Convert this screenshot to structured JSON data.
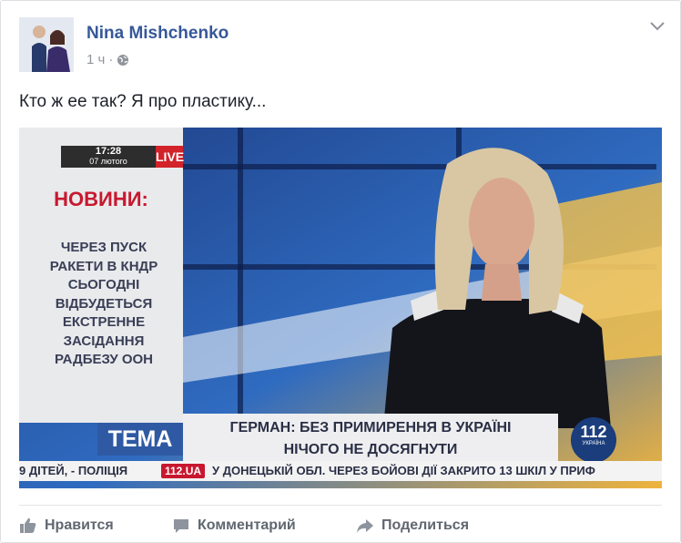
{
  "post": {
    "author": "Nina Mishchenko",
    "time": "1 ч",
    "separator": "·",
    "text": "Кто ж ее так? Я про пластику...",
    "icons": {
      "privacy": "globe-icon",
      "menu": "chevron-down-icon"
    }
  },
  "media": {
    "clock_time": "17:28",
    "clock_date": "07 лютого",
    "live_label": "LIVE",
    "news_title": "НОВИНИ:",
    "news_lines": [
      "ЧЕРЕЗ ПУСК",
      "РАКЕТИ В КНДР",
      "СЬОГОДНІ",
      "ВІДБУДЕТЬСЯ",
      "ЕКСТРЕННЕ",
      "ЗАСІДАННЯ",
      "РАДБЕЗУ ООН"
    ],
    "tema_label": "ТЕМА",
    "headline_line1": "ГЕРМАН: БЕЗ ПРИМИРЕННЯ В УКРАЇНІ",
    "headline_line2": "НІЧОГО НЕ ДОСЯГНУТИ",
    "logo_number": "112",
    "logo_sub": "УКРАЇНА",
    "ticker_left": "9 ДІТЕЙ, - ПОЛІЦІЯ",
    "ticker_site": "112.UA",
    "ticker_right": "У ДОНЕЦЬКІЙ ОБЛ. ЧЕРЕЗ БОЙОВІ ДІЇ ЗАКРИТО 13 ШКІЛ У ПРИФ"
  },
  "actions": {
    "like": "Нравится",
    "comment": "Комментарий",
    "share": "Поделиться",
    "icons": {
      "like": "thumbs-up-icon",
      "comment": "comment-icon",
      "share": "share-icon"
    }
  }
}
